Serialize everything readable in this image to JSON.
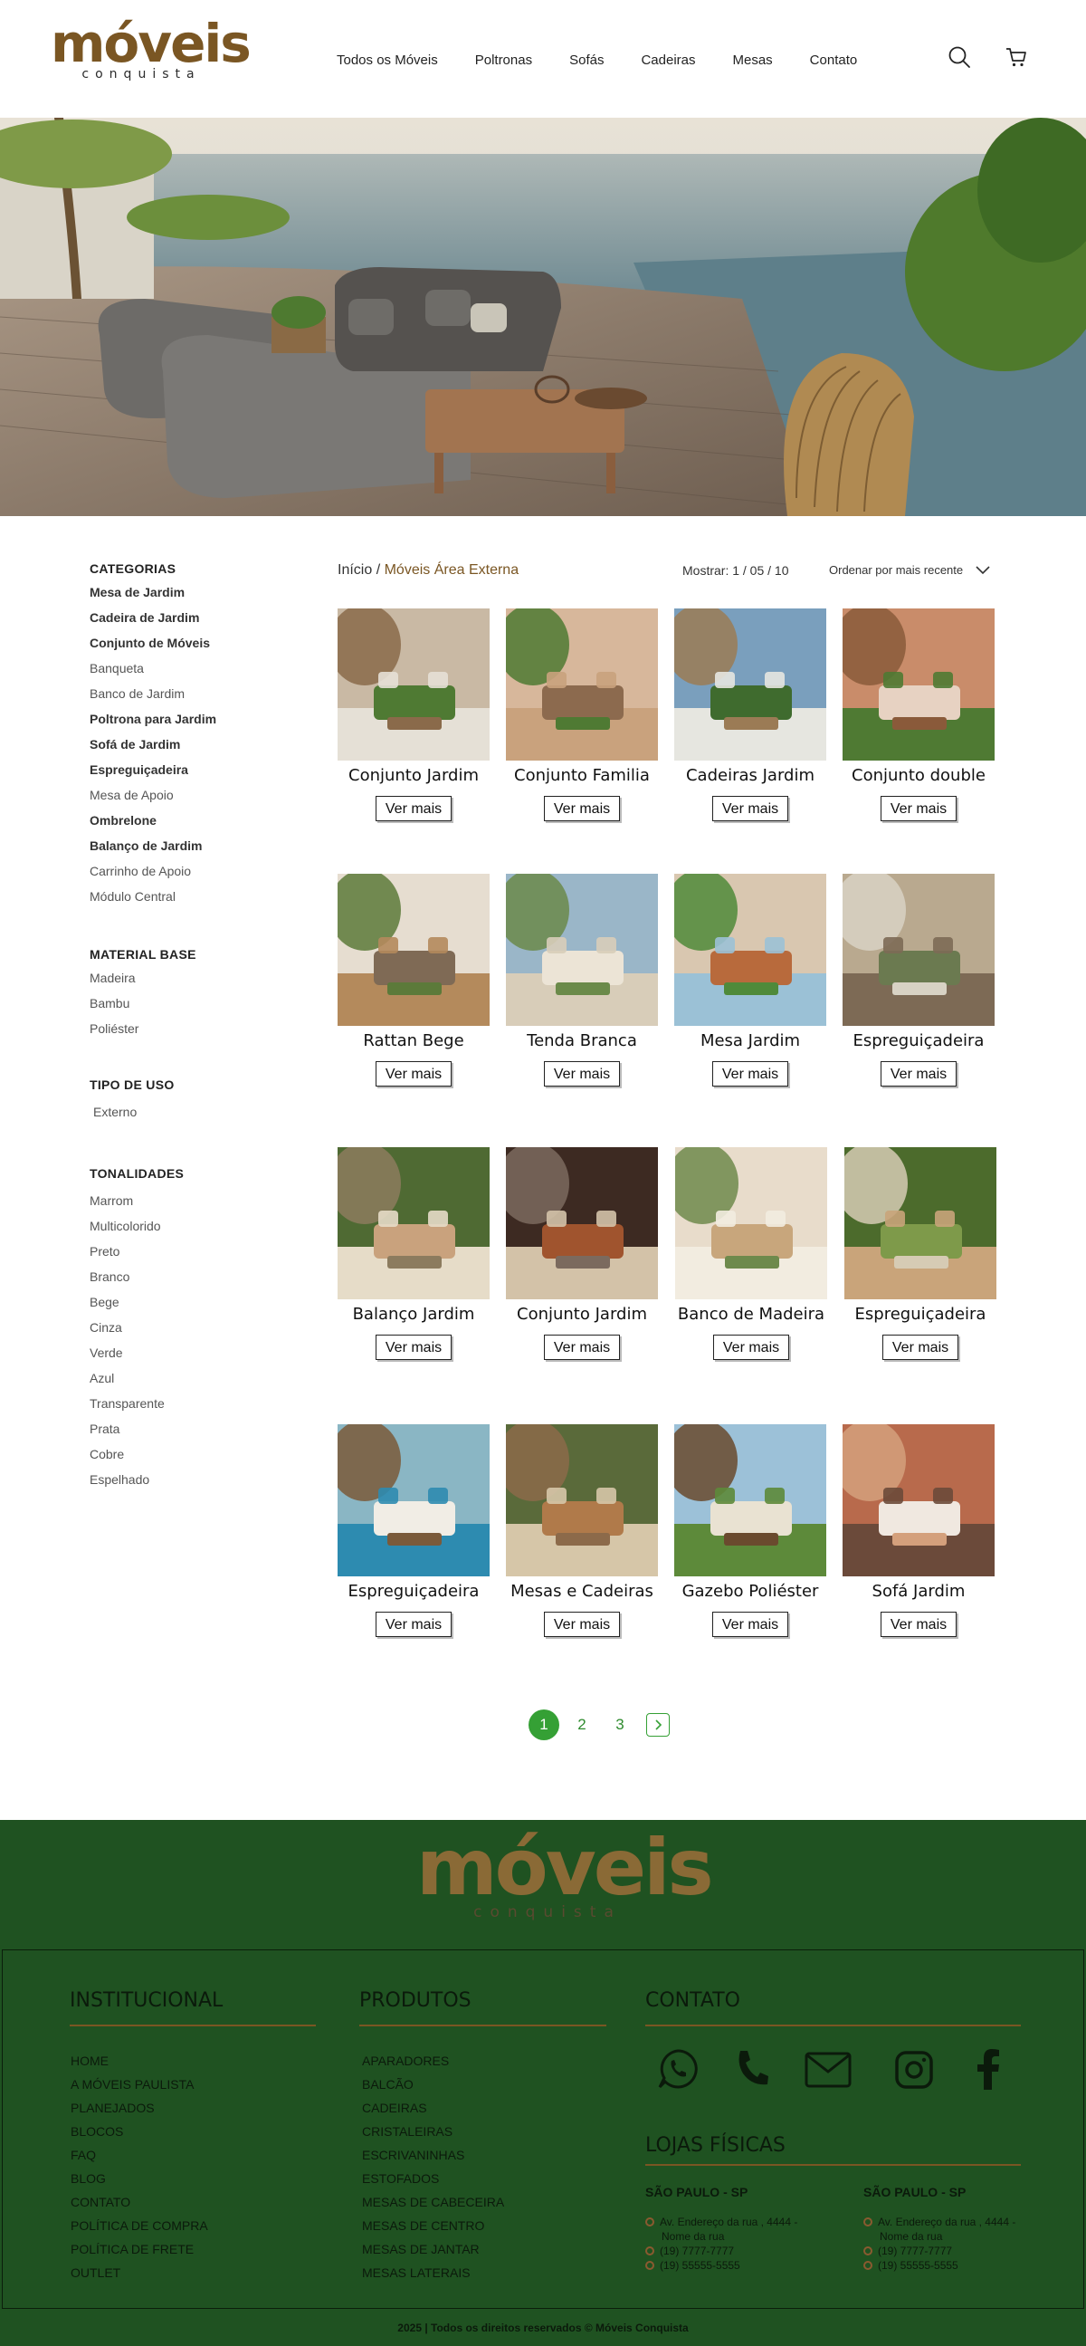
{
  "header": {
    "logo_main": "móveis",
    "logo_sub": "conquista",
    "nav": [
      "Todos os Móveis",
      "Poltronas",
      "Sofás",
      "Cadeiras",
      "Mesas",
      "Contato"
    ]
  },
  "sidebar": {
    "categories_title": "CATEGORIAS",
    "categories": [
      {
        "label": "Mesa de Jardim",
        "bold": true
      },
      {
        "label": "Cadeira de Jardim",
        "bold": true
      },
      {
        "label": "Conjunto de Móveis",
        "bold": true
      },
      {
        "label": "Banqueta",
        "bold": false
      },
      {
        "label": "Banco de Jardim",
        "bold": false
      },
      {
        "label": "Poltrona para Jardim",
        "bold": true
      },
      {
        "label": "Sofá de Jardim",
        "bold": true
      },
      {
        "label": "Espreguiçadeira",
        "bold": true
      },
      {
        "label": "Mesa de Apoio",
        "bold": false
      },
      {
        "label": "Ombrelone",
        "bold": true
      },
      {
        "label": "Balanço de Jardim",
        "bold": true
      },
      {
        "label": "Carrinho de Apoio",
        "bold": false
      },
      {
        "label": "Módulo Central",
        "bold": false
      }
    ],
    "material_title": "MATERIAL BASE",
    "materials": [
      "Madeira",
      "Bambu",
      "Poliéster"
    ],
    "use_title": "TIPO DE USO",
    "uses": [
      "Externo"
    ],
    "tones_title": "TONALIDADES",
    "tones": [
      "Marrom",
      "Multicolorido",
      "Preto",
      "Branco",
      "Bege",
      "Cinza",
      "Verde",
      "Azul",
      "Transparente",
      "Prata",
      "Cobre",
      "Espelhado"
    ]
  },
  "listing": {
    "breadcrumb_home": "Início",
    "breadcrumb_sep": " / ",
    "breadcrumb_current": "Móveis Área Externa",
    "showing": "Mostrar: 1 / 05 / 10",
    "sort_label": "Ordenar por mais recente",
    "button_label": "Ver mais",
    "products": [
      {
        "name": "Conjunto Jardim"
      },
      {
        "name": "Conjunto Familia"
      },
      {
        "name": "Cadeiras Jardim"
      },
      {
        "name": "Conjunto double"
      },
      {
        "name": "Rattan Bege"
      },
      {
        "name": "Tenda Branca"
      },
      {
        "name": "Mesa Jardim"
      },
      {
        "name": "Espreguiçadeira"
      },
      {
        "name": "Balanço Jardim"
      },
      {
        "name": "Conjunto Jardim"
      },
      {
        "name": "Banco de Madeira"
      },
      {
        "name": "Espreguiçadeira"
      },
      {
        "name": "Espreguiçadeira"
      },
      {
        "name": "Mesas e Cadeiras"
      },
      {
        "name": "Gazebo Poliéster"
      },
      {
        "name": "Sofá Jardim"
      }
    ]
  },
  "pagination": {
    "pages": [
      "1",
      "2",
      "3"
    ],
    "active": "1"
  },
  "footer": {
    "logo_main": "móveis",
    "logo_sub": "conquista",
    "institutional_title": "INSTITUCIONAL",
    "institutional": [
      "HOME",
      "A MÓVEIS PAULISTA",
      "PLANEJADOS",
      "BLOCOS",
      "FAQ",
      "BLOG",
      "CONTATO",
      "POLÍTICA DE COMPRA",
      "POLÍTICA DE FRETE",
      "OUTLET"
    ],
    "products_title": "PRODUTOS",
    "products": [
      "APARADORES",
      "BALCÃO",
      "CADEIRAS",
      "CRISTALEIRAS",
      "ESCRIVANINHAS",
      "ESTOFADOS",
      "MESAS DE CABECEIRA",
      "MESAS DE CENTRO",
      "MESAS DE JANTAR",
      "MESAS LATERAIS"
    ],
    "contact_title": "CONTATO",
    "social_icons": [
      "whatsapp-icon",
      "phone-icon",
      "mail-icon",
      "instagram-icon",
      "facebook-icon"
    ],
    "stores_title": "LOJAS FÍSICAS",
    "stores": [
      {
        "city": "SÃO PAULO - SP",
        "address": "Av. Endereço da rua , 4444 -",
        "address2": "Nome da rua",
        "phone1": "(19) 7777-7777",
        "phone2": "(19) 55555-5555"
      },
      {
        "city": "SÃO PAULO - SP",
        "address": "Av. Endereço da rua , 4444 -",
        "address2": "Nome da rua",
        "phone1": "(19) 7777-7777",
        "phone2": "(19) 55555-5555"
      }
    ],
    "copyright": "2025 | Todos os direitos reservados © Móveis Conquista"
  },
  "colors": {
    "brand_brown": "#7a5623",
    "footer_green": "#1f5221",
    "accent_green": "#35a035"
  }
}
